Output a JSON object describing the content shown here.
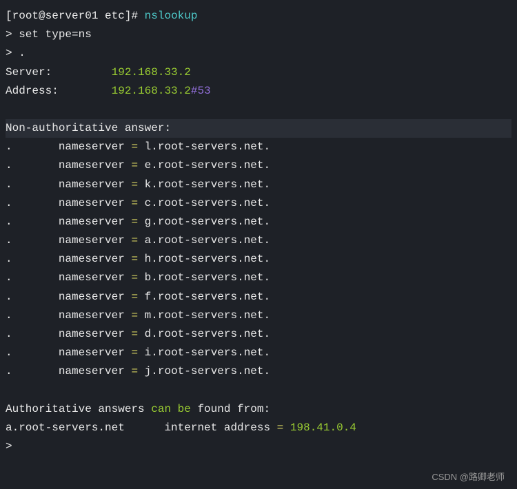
{
  "prompt": {
    "bracket_open": "[",
    "user_host": "root@server01 etc",
    "bracket_close": "]# ",
    "command": "nslookup"
  },
  "input_lines": [
    {
      "prompt": "> ",
      "text": "set type=ns"
    },
    {
      "prompt": "> ",
      "text": "."
    }
  ],
  "server_info": {
    "server_label": "Server:",
    "server_value": "192.168.33.2",
    "address_label": "Address:",
    "address_value": "192.168.33.2",
    "hash": "#",
    "port": "53"
  },
  "non_auth_header": "Non-authoritative answer:",
  "nameservers": [
    {
      "dot": ".",
      "label": "nameserver",
      "eq": "=",
      "value": "l.root-servers.net."
    },
    {
      "dot": ".",
      "label": "nameserver",
      "eq": "=",
      "value": "e.root-servers.net."
    },
    {
      "dot": ".",
      "label": "nameserver",
      "eq": "=",
      "value": "k.root-servers.net."
    },
    {
      "dot": ".",
      "label": "nameserver",
      "eq": "=",
      "value": "c.root-servers.net."
    },
    {
      "dot": ".",
      "label": "nameserver",
      "eq": "=",
      "value": "g.root-servers.net."
    },
    {
      "dot": ".",
      "label": "nameserver",
      "eq": "=",
      "value": "a.root-servers.net."
    },
    {
      "dot": ".",
      "label": "nameserver",
      "eq": "=",
      "value": "h.root-servers.net."
    },
    {
      "dot": ".",
      "label": "nameserver",
      "eq": "=",
      "value": "b.root-servers.net."
    },
    {
      "dot": ".",
      "label": "nameserver",
      "eq": "=",
      "value": "f.root-servers.net."
    },
    {
      "dot": ".",
      "label": "nameserver",
      "eq": "=",
      "value": "m.root-servers.net."
    },
    {
      "dot": ".",
      "label": "nameserver",
      "eq": "=",
      "value": "d.root-servers.net."
    },
    {
      "dot": ".",
      "label": "nameserver",
      "eq": "=",
      "value": "i.root-servers.net."
    },
    {
      "dot": ".",
      "label": "nameserver",
      "eq": "=",
      "value": "j.root-servers.net."
    }
  ],
  "auth_footer": {
    "text1": "Authoritative answers ",
    "text2": "can be",
    "text3": " found from:",
    "host": "a.root-servers.net",
    "label": "internet address",
    "eq": "=",
    "ip": "198.41.0.4"
  },
  "final_prompt": ">",
  "watermark": "CSDN @路卿老师"
}
